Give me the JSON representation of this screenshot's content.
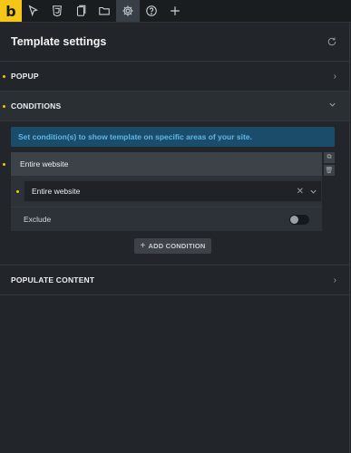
{
  "toolbar": {
    "logo": "b",
    "icons": [
      "cursor-icon",
      "css3-icon",
      "pages-icon",
      "folder-icon",
      "gear-icon",
      "help-icon",
      "plus-icon"
    ],
    "active": "gear-icon"
  },
  "panel": {
    "title": "Template settings"
  },
  "sections": {
    "popup": "POPUP",
    "conditions": "CONDITIONS",
    "populate": "POPULATE CONTENT"
  },
  "conditions": {
    "info": "Set condition(s) to show template on specific areas of your site.",
    "condition_title": "Entire website",
    "select_value": "Entire website",
    "exclude_label": "Exclude",
    "exclude_on": false,
    "add_label": "ADD CONDITION"
  },
  "colors": {
    "accent": "#f5c518",
    "info_bg": "#1b4d6b",
    "info_text": "#5db6e8"
  }
}
